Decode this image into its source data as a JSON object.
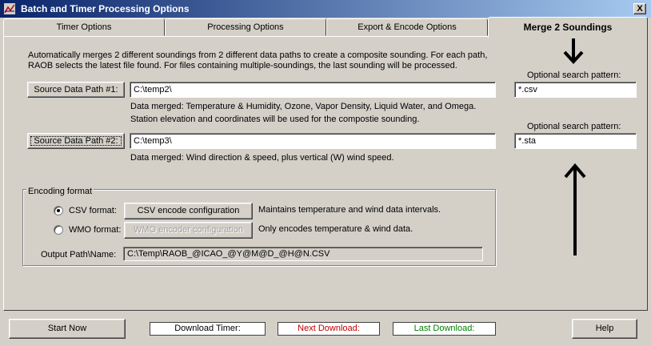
{
  "window": {
    "title": "Batch and Timer Processing Options",
    "close_label": "X"
  },
  "tabs": [
    {
      "label": "Timer Options"
    },
    {
      "label": "Processing Options"
    },
    {
      "label": "Export & Encode Options"
    },
    {
      "label": "Merge 2 Soundings"
    }
  ],
  "description": {
    "line1": "Automatically merges 2 different soundings from 2 different data paths to create a composite sounding.  For each path,",
    "line2": "RAOB selects the latest file found.  For files containing multiple-soundings, the last sounding will be processed."
  },
  "source1": {
    "button_label": "Source Data Path #1:",
    "path_value": "C:\\temp2\\",
    "info_line1": "Data merged: Temperature & Humidity, Ozone, Vapor Density, Liquid Water, and Omega.",
    "info_line2": "Station elevation and coordinates will be used for the compostie sounding.",
    "pattern_label": "Optional search pattern:",
    "pattern_value": "*.csv"
  },
  "source2": {
    "button_label": "Source Data Path #2:",
    "path_value": "C:\\temp3\\",
    "info_line1": "Data merged: Wind direction & speed, plus vertical (W) wind speed.",
    "pattern_label": "Optional search pattern:",
    "pattern_value": "*.sta"
  },
  "encoding": {
    "legend": "Encoding format",
    "csv_radio_label": "CSV format:",
    "csv_button_label": "CSV encode configuration",
    "csv_note": "Maintains temperature and wind data intervals.",
    "wmo_radio_label": "WMO format:",
    "wmo_button_label": "WMO encoder configuration",
    "wmo_note": "Only encodes temperature & wind data.",
    "output_label": "Output Path\\Name:",
    "output_value": "C:\\Temp\\RAOB_@ICAO_@Y@M@D_@H@N.CSV",
    "selected": "csv"
  },
  "footer": {
    "start_label": "Start Now",
    "download_timer_label": "Download Timer:",
    "next_download_label": "Next Download:",
    "last_download_label": "Last Download:",
    "help_label": "Help"
  },
  "colors": {
    "next_download": "#c00000",
    "last_download": "#008000",
    "title_start": "#0a246a",
    "title_end": "#a6caf0"
  }
}
